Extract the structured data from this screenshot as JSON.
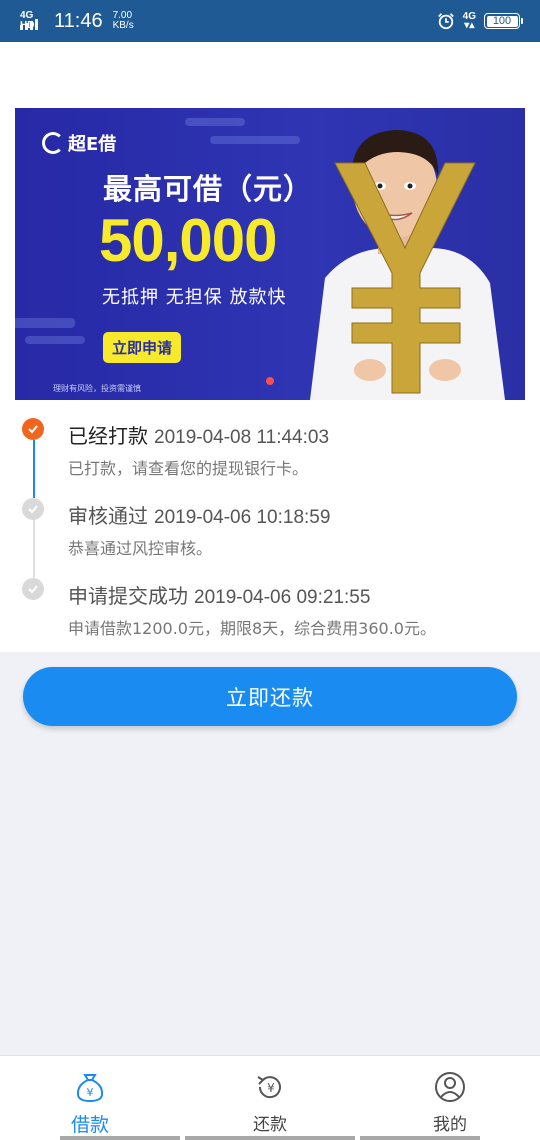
{
  "status_bar": {
    "network_tag": "4G HD",
    "time": "11:46",
    "speed_value": "7.00",
    "speed_unit": "KB/s",
    "net_right": "4G",
    "battery": "100"
  },
  "banner": {
    "logo_text": "超E借",
    "headline": "最高可借（元）",
    "amount": "50,000",
    "subline": "无抵押  无担保  放款快",
    "apply_label": "立即申请",
    "disclaimer": "理财有风险，投资需谨慎"
  },
  "timeline": [
    {
      "title": "已经打款",
      "time": "2019-04-08 11:44:03",
      "desc": "已打款，请查看您的提现银行卡。",
      "status": "active"
    },
    {
      "title": "审核通过",
      "time": "2019-04-06 10:18:59",
      "desc": "恭喜通过风控审核。",
      "status": "done"
    },
    {
      "title": "申请提交成功",
      "time": "2019-04-06 09:21:55",
      "desc": "申请借款1200.0元，期限8天，综合费用360.0元。",
      "status": "done"
    }
  ],
  "repay_button": "立即还款",
  "tabs": [
    {
      "label": "借款",
      "icon": "money-bag-icon",
      "active": true
    },
    {
      "label": "还款",
      "icon": "repay-cycle-icon",
      "active": false
    },
    {
      "label": "我的",
      "icon": "user-profile-icon",
      "active": false
    }
  ],
  "colors": {
    "accent": "#1a8bf0",
    "status_bar": "#1f5a94",
    "timeline_active": "#f0661e",
    "banner_bg": "#2a2fa5",
    "banner_highlight": "#f7ea2c"
  }
}
